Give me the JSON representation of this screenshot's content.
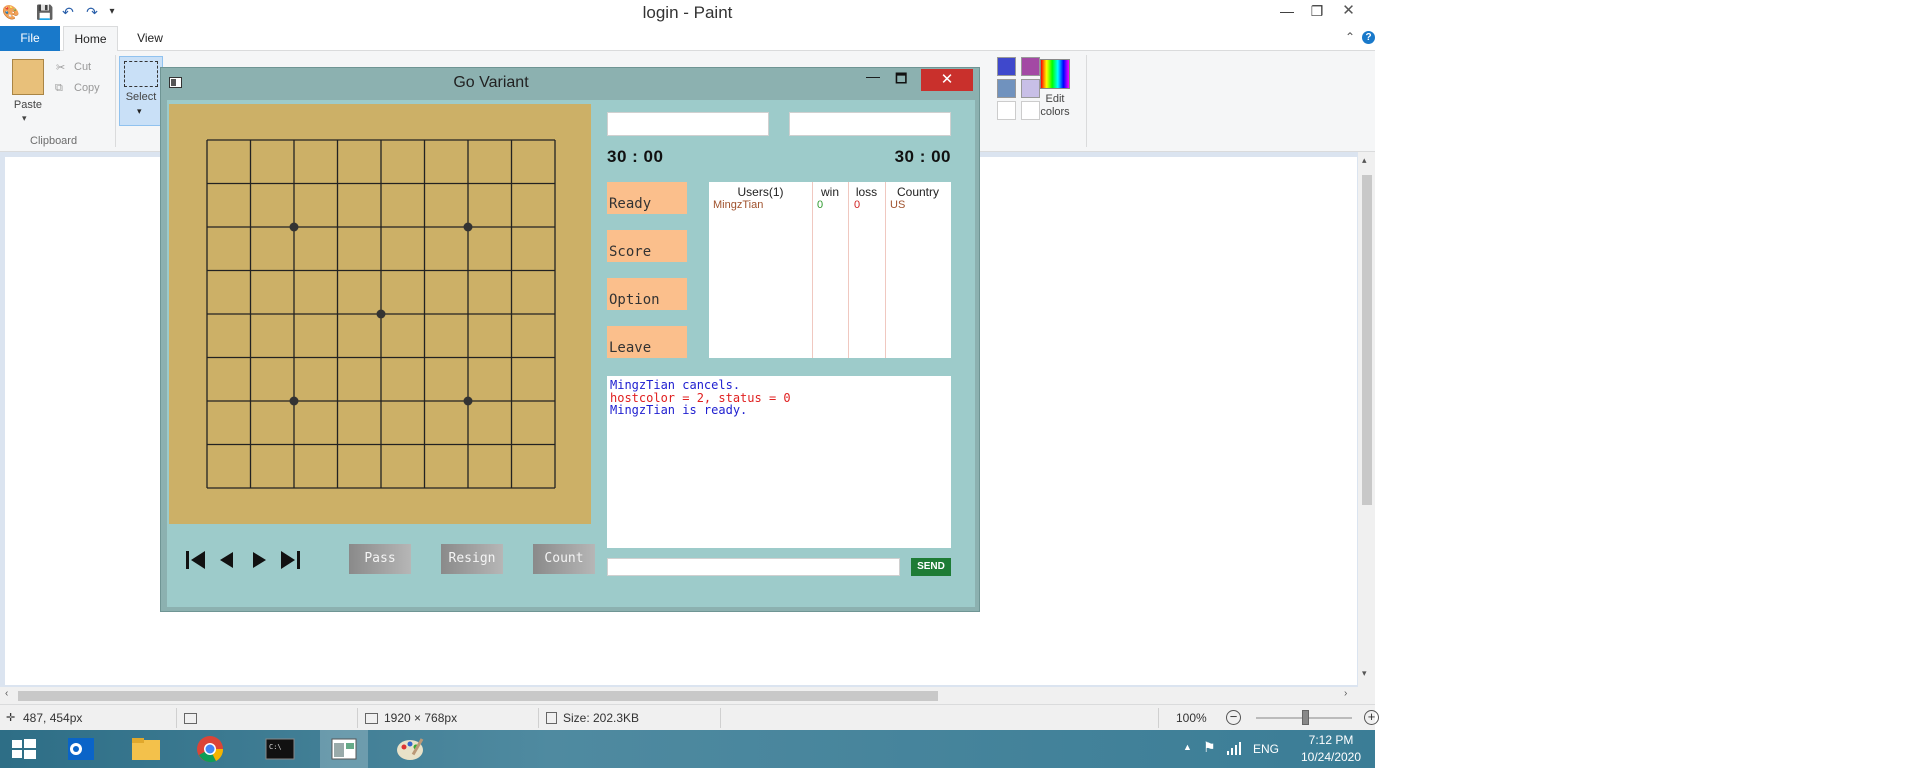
{
  "paint": {
    "title": "login - Paint",
    "tabs": {
      "file": "File",
      "home": "Home",
      "view": "View"
    },
    "ribbon": {
      "paste": "Paste",
      "cut": "Cut",
      "copy": "Copy",
      "clipboard_group": "Clipboard",
      "select": "Select",
      "edit_colors": "Edit colors"
    },
    "palette": [
      "#000000",
      "#7f7f7f",
      "#880015",
      "#ed1c24",
      "#ff7f27",
      "#fff200",
      "#22b14c",
      "#00a2e8",
      "#3f48cc",
      "#a349a4",
      "#ffffff",
      "#c3c3c3",
      "#b97a57",
      "#ffaec9",
      "#ffc90e",
      "#efe4b0",
      "#b5e61d",
      "#99d9ea",
      "#7092be",
      "#c8bfe7"
    ],
    "status": {
      "cursor_pos": "487, 454px",
      "dimensions": "1920 × 768px",
      "size": "Size: 202.3KB",
      "zoom": "100%"
    }
  },
  "taskbar": {
    "apps": [
      "windows-start-icon",
      "outlook-icon",
      "file-explorer-icon",
      "chrome-icon",
      "command-prompt-icon",
      "go-variant-app-icon",
      "paint-icon"
    ],
    "language": "ENG",
    "time": "7:12 PM",
    "date": "10/24/2020"
  },
  "go": {
    "title": "Go Variant",
    "board": {
      "size": 9,
      "star_points": [
        [
          2,
          2
        ],
        [
          6,
          2
        ],
        [
          4,
          4
        ],
        [
          2,
          6
        ],
        [
          6,
          6
        ]
      ],
      "colors": {
        "board": "#ccb067",
        "line": "#222222"
      }
    },
    "timer_left": "30 : 00",
    "timer_right": "30 : 00",
    "buttons": {
      "ready": "Ready",
      "score": "Score",
      "option": "Option",
      "leave": "Leave"
    },
    "users": {
      "headers": {
        "users": "Users(1)",
        "win": "win",
        "loss": "loss",
        "country": "Country"
      },
      "rows": [
        {
          "name": "MingzTian",
          "win": "0",
          "loss": "0",
          "country": "US"
        }
      ]
    },
    "chat": [
      {
        "text": "MingzTian cancels.",
        "color": "#2020d0"
      },
      {
        "text": "hostcolor = 2, status = 0",
        "color": "#e02020"
      },
      {
        "text": "MingzTian is ready.",
        "color": "#2020d0"
      }
    ],
    "controls": {
      "pass": "Pass",
      "resign": "Resign",
      "count": "Count",
      "send": "SEND"
    },
    "nav_icons": [
      "first-move-icon",
      "previous-move-icon",
      "next-move-icon",
      "last-move-icon"
    ]
  }
}
